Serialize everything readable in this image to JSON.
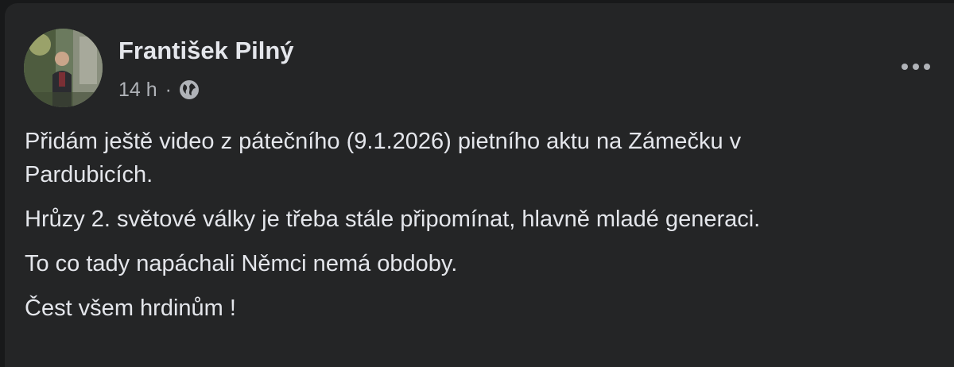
{
  "post": {
    "author": "František Pilný",
    "timestamp": "14 h",
    "separator": "·",
    "audience_icon": "globe-icon",
    "more_icon": "more-options-icon",
    "text_lines": [
      "Přidám ještě video z pátečního (9.1.2026) pietního aktu na Zámečku v",
      "Pardubicích.",
      "Hrůzy 2. světové války je třeba stále připomínat,  hlavně mladé generaci.",
      "To co tady napáchali Němci nemá obdoby.",
      "Čest všem hrdinům !"
    ]
  },
  "colors": {
    "background": "#18191a",
    "card": "#242526",
    "primary_text": "#e4e6eb",
    "secondary_text": "#b0b3b8"
  }
}
